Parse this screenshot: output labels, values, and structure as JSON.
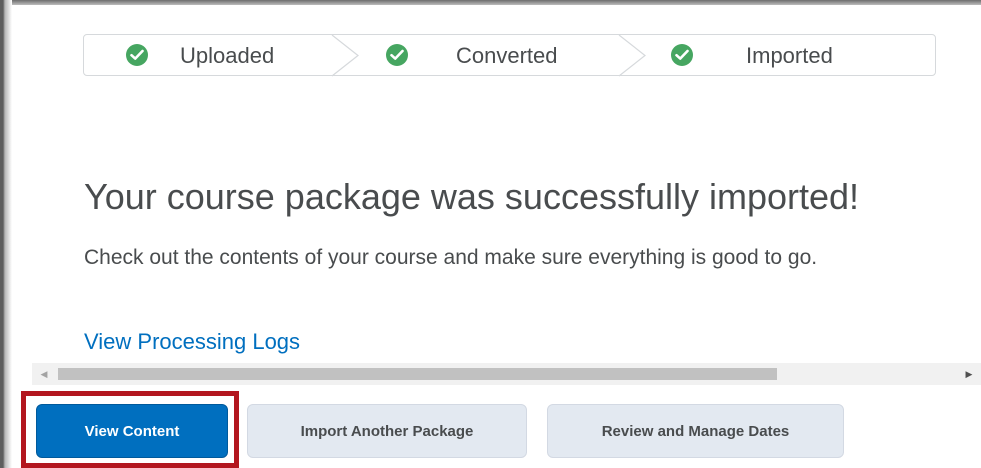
{
  "stepper": {
    "steps": [
      {
        "label": "Uploaded",
        "status": "complete"
      },
      {
        "label": "Converted",
        "status": "complete"
      },
      {
        "label": "Imported",
        "status": "complete"
      }
    ]
  },
  "message": {
    "headline": "Your course package was successfully imported!",
    "body": "Check out the contents of your course and make sure everything is good to go.",
    "logs_link": "View Processing Logs"
  },
  "actions": {
    "view_content": "View Content",
    "import_another": "Import Another Package",
    "review_dates": "Review and Manage Dates"
  },
  "colors": {
    "success": "#46a661",
    "primary": "#006fbf",
    "secondary_bg": "#e3e9f1",
    "text": "#494c4e",
    "highlight": "#b3161f"
  },
  "icons": {
    "step_status": "check-circle-icon",
    "step_separator": "chevron-right-icon",
    "scroll_left": "triangle-left-icon",
    "scroll_right": "triangle-right-icon"
  }
}
